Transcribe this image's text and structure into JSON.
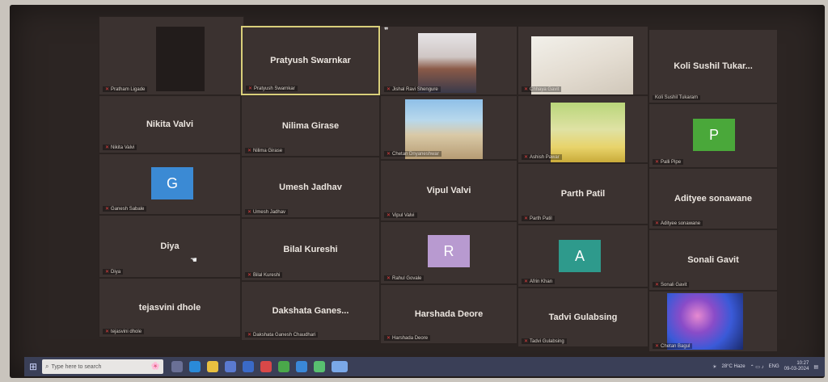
{
  "tiles": [
    {
      "id": "t1",
      "name": "",
      "label": "Pratham Ligade"
    },
    {
      "id": "t2",
      "name": "Pratyush Swarnkar",
      "label": "Pratyush Swarnkar"
    },
    {
      "id": "t3",
      "name": "",
      "label": "Jishal Ravi Shengure"
    },
    {
      "id": "t4",
      "name": "",
      "label": "Chhaya Gavit"
    },
    {
      "id": "t5",
      "name": "Koli Sushil Tukar...",
      "label": "Koli Sushil Tukaram"
    },
    {
      "id": "t6",
      "name": "Nikita Valvi",
      "label": "Nikita Valvi"
    },
    {
      "id": "t7",
      "name": "Nilima Girase",
      "label": "Nilima Girase"
    },
    {
      "id": "t8",
      "name": "",
      "label": "Chetan Dnyaneshwar"
    },
    {
      "id": "t9",
      "name": "",
      "label": "Ashish Pawar"
    },
    {
      "id": "t10",
      "name": "",
      "label": "Palli Pipe",
      "avatar": "P",
      "avatar_color": "#4aa83a"
    },
    {
      "id": "t11",
      "name": "",
      "label": "Ganesh Sabale",
      "avatar": "G",
      "avatar_color": "#3b8ad4"
    },
    {
      "id": "t12",
      "name": "Umesh Jadhav",
      "label": "Umesh Jadhav"
    },
    {
      "id": "t13",
      "name": "Vipul Valvi",
      "label": "Vipul Valvi"
    },
    {
      "id": "t14",
      "name": "Parth Patil",
      "label": "Parth Patil"
    },
    {
      "id": "t15",
      "name": "Adityee sonawane",
      "label": "Adityee sonawane"
    },
    {
      "id": "t16",
      "name": "Diya",
      "label": "Diya"
    },
    {
      "id": "t17",
      "name": "Bilal Kureshi",
      "label": "Bilal Kureshi"
    },
    {
      "id": "t18",
      "name": "",
      "label": "Rahul Govale",
      "avatar": "R",
      "avatar_color": "#b89ad0"
    },
    {
      "id": "t19",
      "name": "",
      "label": "Afrin Khan",
      "avatar": "A",
      "avatar_color": "#2e9a8c"
    },
    {
      "id": "t20",
      "name": "Sonali Gavit",
      "label": "Sonali Gavit"
    },
    {
      "id": "t21",
      "name": "tejasvini dhole",
      "label": "tejasvini dhole"
    },
    {
      "id": "t22",
      "name": "Dakshata Ganes...",
      "label": "Dakshata Ganesh Chaudhari"
    },
    {
      "id": "t23",
      "name": "Harshada Deore",
      "label": "Harshada Deore"
    },
    {
      "id": "t24",
      "name": "Tadvi Gulabsing",
      "label": "Tadvi Gulabsing"
    },
    {
      "id": "t25",
      "name": "",
      "label": "Chetan Bagul"
    }
  ],
  "taskbar": {
    "search_placeholder": "Type here to search",
    "weather": "28°C Haze",
    "lang": "ENG",
    "time": "10:27",
    "date": "09-03-2024"
  },
  "colors": {
    "tile_bg": "#3b3230",
    "active_border": "#d9cf7a",
    "taskbar_bg": "#3a3f57"
  }
}
